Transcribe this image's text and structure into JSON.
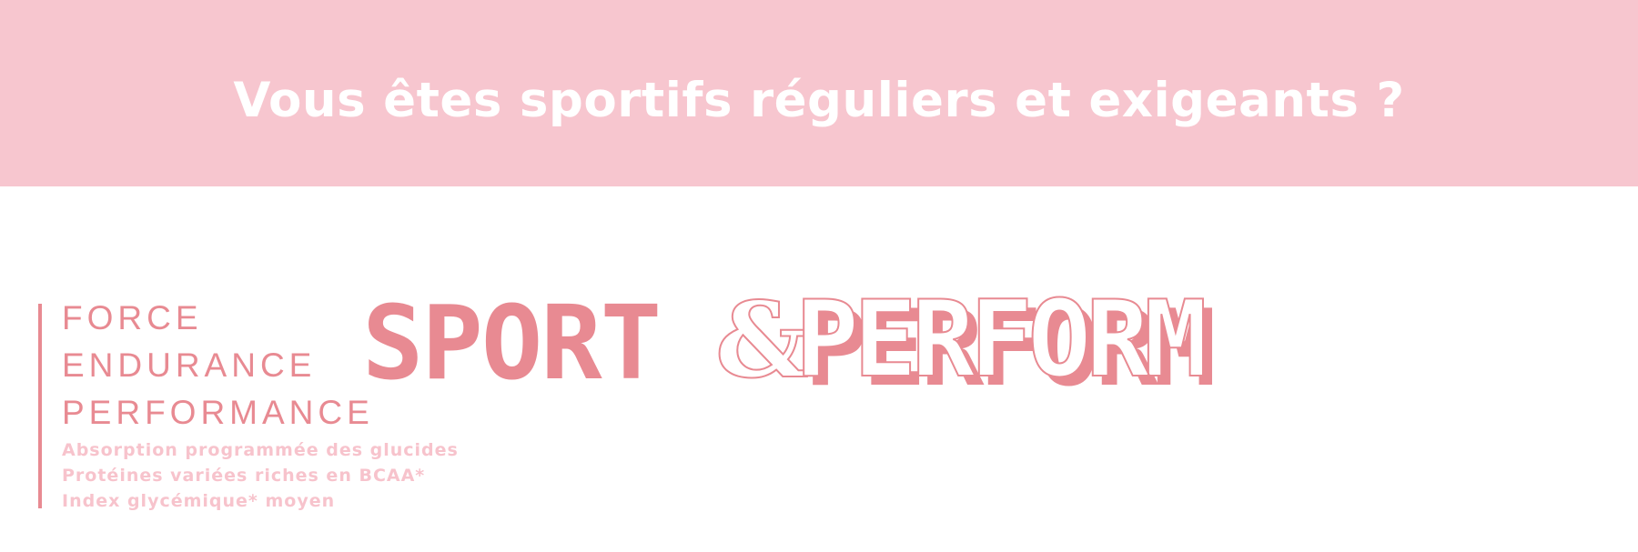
{
  "banner": {
    "title": "Vous êtes sportifs réguliers et exigeants ?"
  },
  "taglines": [
    "FORCE",
    "ENDURANCE",
    "PERFORMANCE"
  ],
  "benefits": [
    "Absorption programmée des glucides",
    "Protéines variées riches en BCAA*",
    "Index glycémique* moyen"
  ],
  "logo": {
    "word1": "SPORT",
    "ampersand": "&",
    "word2": "PERFORM"
  },
  "colors": {
    "banner_bg": "#f7c6cf",
    "accent": "#e88a92",
    "benefit_text": "#f7c3cc",
    "white": "#ffffff"
  }
}
